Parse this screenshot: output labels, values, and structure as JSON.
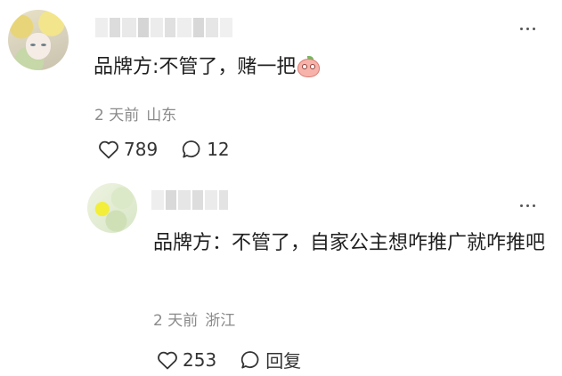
{
  "comments": [
    {
      "text": "品牌方:不管了，赌一把",
      "emoji": "peach-face-emoji",
      "time": "2 天前",
      "location": "山东",
      "likes": "789",
      "replies": "12"
    }
  ],
  "reply": {
    "text": "品牌方：不管了，自家公主想咋推广就咋推吧",
    "time": "2 天前",
    "location": "浙江",
    "likes": "253",
    "reply_label": "回复"
  },
  "icons": {
    "like": "heart-outline-icon",
    "comment": "speech-bubble-icon",
    "more": "more-dots-icon"
  },
  "colors": {
    "meta": "#8a8a8a",
    "text": "#1f1f1f",
    "icon": "#333333"
  }
}
